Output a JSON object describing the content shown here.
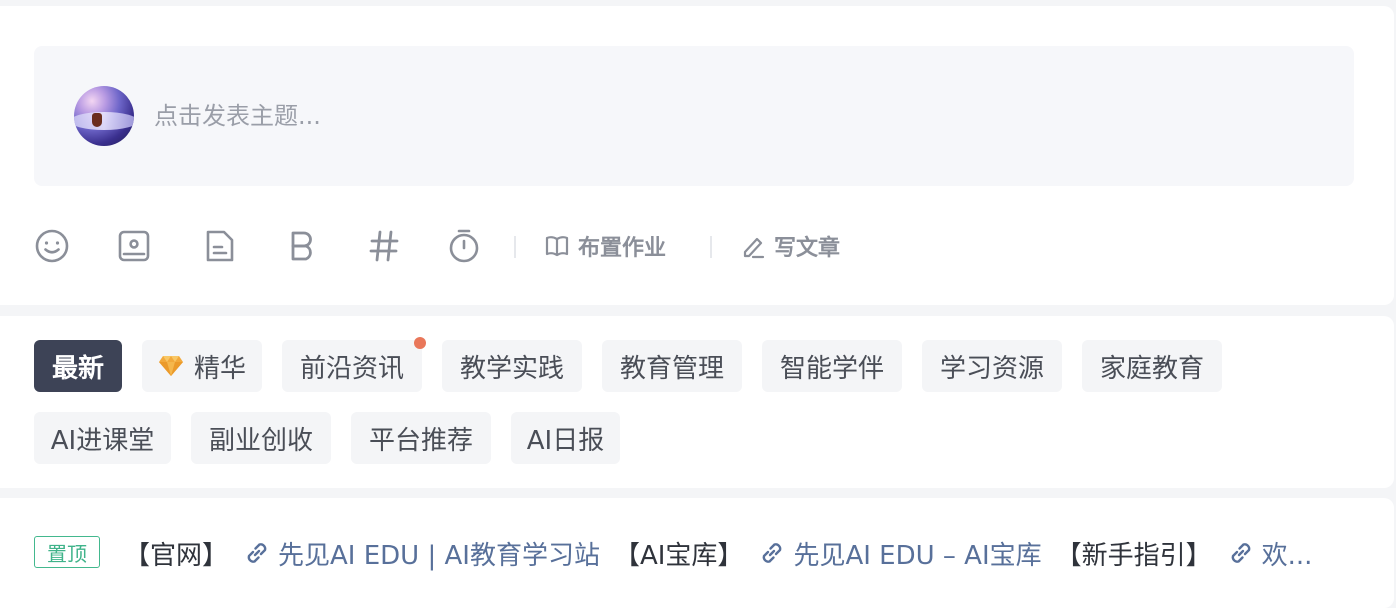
{
  "composer": {
    "placeholder": "点击发表主题...",
    "toolbar": {
      "icons": [
        "smile-icon",
        "image-icon",
        "document-icon",
        "bold-icon",
        "hashtag-icon",
        "timer-icon"
      ],
      "assign_homework_label": "布置作业",
      "write_article_label": "写文章"
    }
  },
  "tabs": [
    {
      "label": "最新",
      "active": true
    },
    {
      "label": "精华",
      "icon": "diamond-icon"
    },
    {
      "label": "前沿资讯",
      "has_dot": true
    },
    {
      "label": "教学实践"
    },
    {
      "label": "教育管理"
    },
    {
      "label": "智能学伴"
    },
    {
      "label": "学习资源"
    },
    {
      "label": "家庭教育"
    },
    {
      "label": "AI进课堂"
    },
    {
      "label": "副业创收"
    },
    {
      "label": "平台推荐"
    },
    {
      "label": "AI日报"
    }
  ],
  "pinned": {
    "badge": "置顶",
    "items": [
      {
        "tag": "【官网】",
        "link": "先见AI EDU | AI教育学习站"
      },
      {
        "tag": "【AI宝库】",
        "link": "先见AI EDU – AI宝库"
      },
      {
        "tag": "【新手指引】",
        "link": "欢..."
      }
    ]
  },
  "colors": {
    "active_tab_bg": "#3d4356",
    "link": "#58709a",
    "pin_green": "#3fb38a",
    "notification_dot": "#e9775a"
  }
}
